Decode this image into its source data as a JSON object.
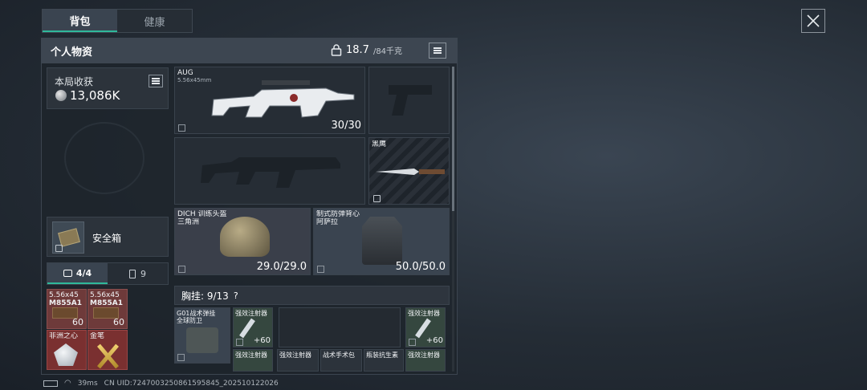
{
  "tabs": [
    {
      "label": "背包",
      "active": true
    },
    {
      "label": "健康",
      "active": false
    }
  ],
  "panel": {
    "title": "个人物资",
    "weight_current": "18.7",
    "weight_max": "/84千克"
  },
  "harvest": {
    "label": "本局收获",
    "value": "13,086K"
  },
  "safe_box": {
    "label": "安全箱"
  },
  "pouch_tabs": {
    "first": "4/4",
    "second": "9"
  },
  "pouch_items": [
    {
      "line1": "5.56x45",
      "line2": "M855A1",
      "count": "60"
    },
    {
      "line1": "5.56x45",
      "line2": "M855A1",
      "count": "60"
    },
    {
      "line1": "非洲之心",
      "line2": "",
      "count": ""
    },
    {
      "line1": "金笔",
      "line2": "",
      "count": ""
    }
  ],
  "weapons": {
    "primary": {
      "name": "AUG",
      "ammo": "5.56x45mm",
      "count": "30/30"
    },
    "melee": {
      "name": "黑鹰"
    }
  },
  "helmet": {
    "line1": "DICH 训练头盔",
    "line2": "三角洲",
    "durability": "29.0/29.0"
  },
  "armor": {
    "line1": "制式防弹背心",
    "line2": "阿萨拉",
    "durability": "50.0/50.0"
  },
  "rig": {
    "title": "胸挂: 9/13",
    "help": "?",
    "name_line1": "G01战术弹挂",
    "name_line2": "全球防卫"
  },
  "rig_items": [
    {
      "label": "强效注射器",
      "count": "+60"
    },
    {
      "label": "强效注射器",
      "count": "+60"
    },
    {
      "label": "强效注射器",
      "count": ""
    },
    {
      "label": "强效注射器",
      "count": ""
    },
    {
      "label": "战术手术包",
      "count": ""
    },
    {
      "label": "瓶装抗生素",
      "count": ""
    },
    {
      "label": "强效注射器",
      "count": ""
    }
  ],
  "status": {
    "ping": "39ms",
    "uid": "CN UID:7247003250861595845_202510122026"
  },
  "colors": {
    "accent": "#2fb89a",
    "header": "#3d4651"
  }
}
